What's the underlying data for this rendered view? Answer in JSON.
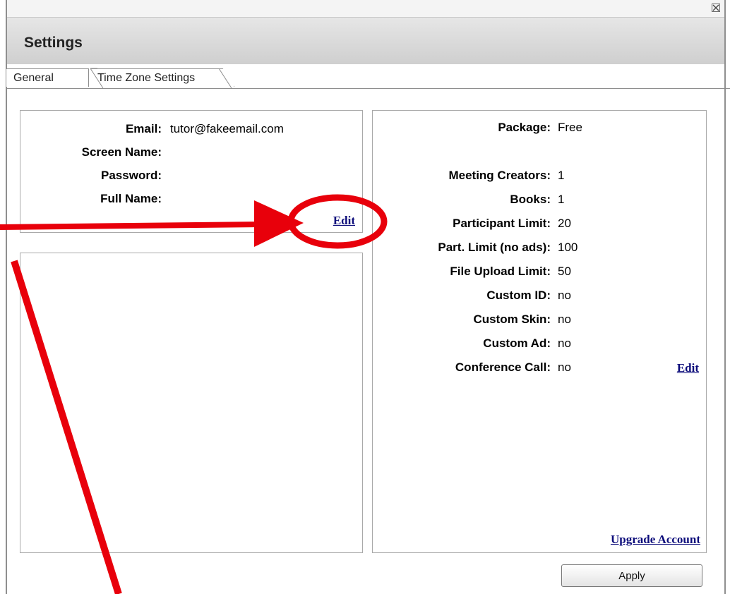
{
  "dialog": {
    "title": "Settings",
    "close_icon": "close-icon"
  },
  "tabs": [
    {
      "label": "General",
      "active": true
    },
    {
      "label": "Time Zone Settings",
      "active": false
    }
  ],
  "account": {
    "fields": [
      {
        "label": "Email:",
        "value": "tutor@fakeemail.com"
      },
      {
        "label": "Screen Name:",
        "value": ""
      },
      {
        "label": "Password:",
        "value": ""
      },
      {
        "label": "Full Name:",
        "value": ""
      }
    ],
    "edit_label": "Edit"
  },
  "plan": {
    "fields": [
      {
        "label": "Package:",
        "value": "Free"
      },
      {
        "label": "Meeting Creators:",
        "value": "1"
      },
      {
        "label": "Books:",
        "value": "1"
      },
      {
        "label": "Participant Limit:",
        "value": "20"
      },
      {
        "label": "Part. Limit (no ads):",
        "value": "100"
      },
      {
        "label": "File Upload Limit:",
        "value": "50"
      },
      {
        "label": "Custom ID:",
        "value": "no"
      },
      {
        "label": "Custom Skin:",
        "value": "no"
      },
      {
        "label": "Custom Ad:",
        "value": "no"
      },
      {
        "label": "Conference Call:",
        "value": "no"
      }
    ],
    "edit_label": "Edit",
    "upgrade_label": "Upgrade Account"
  },
  "footer": {
    "apply_label": "Apply"
  },
  "annotation": {
    "color": "#e8000b"
  }
}
